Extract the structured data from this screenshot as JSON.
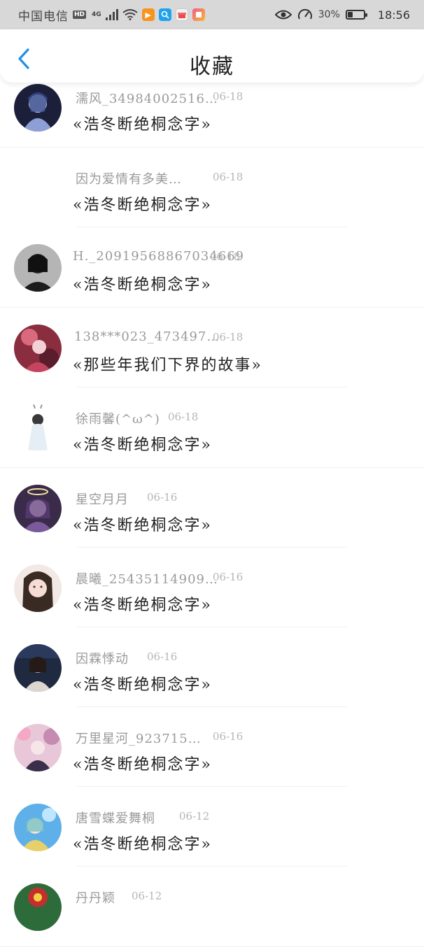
{
  "status_bar": {
    "carrier": "中国电信",
    "hd": "HD",
    "network": "4G",
    "battery_percent": "30%",
    "battery_level": 0.3,
    "time": "18:56"
  },
  "header": {
    "title": "收藏",
    "back_icon": "chevron-left-icon",
    "accent_color": "#1e90e8"
  },
  "items": [
    {
      "nickname": "濡风_34984002516…",
      "date": "06-18",
      "book": "«浩冬断绝桐念字»"
    },
    {
      "nickname": "因为爱情有多美…",
      "date": "06-18",
      "book": "«浩冬断绝桐念字»"
    },
    {
      "nickname": "H._20919568867034669",
      "date": "06-18",
      "book": "«浩冬断绝桐念字»"
    },
    {
      "nickname": "138***023_473497…",
      "date": "06-18",
      "book": "«那些年我们下界的故事»"
    },
    {
      "nickname": "徐雨馨(^ω^)",
      "date": "06-18",
      "book": "«浩冬断绝桐念字»"
    },
    {
      "nickname": "星空月月",
      "date": "06-16",
      "book": "«浩冬断绝桐念字»"
    },
    {
      "nickname": "晨曦_25435114909…",
      "date": "06-16",
      "book": "«浩冬断绝桐念字»"
    },
    {
      "nickname": "因霖悸动",
      "date": "06-16",
      "book": "«浩冬断绝桐念字»"
    },
    {
      "nickname": "万里星河_923715…",
      "date": "06-16",
      "book": "«浩冬断绝桐念字»"
    },
    {
      "nickname": "唐雪蝶爱舞桐",
      "date": "06-12",
      "book": "«浩冬断绝桐念字»"
    },
    {
      "nickname": "丹丹颖",
      "date": "06-12",
      "book": ""
    }
  ]
}
